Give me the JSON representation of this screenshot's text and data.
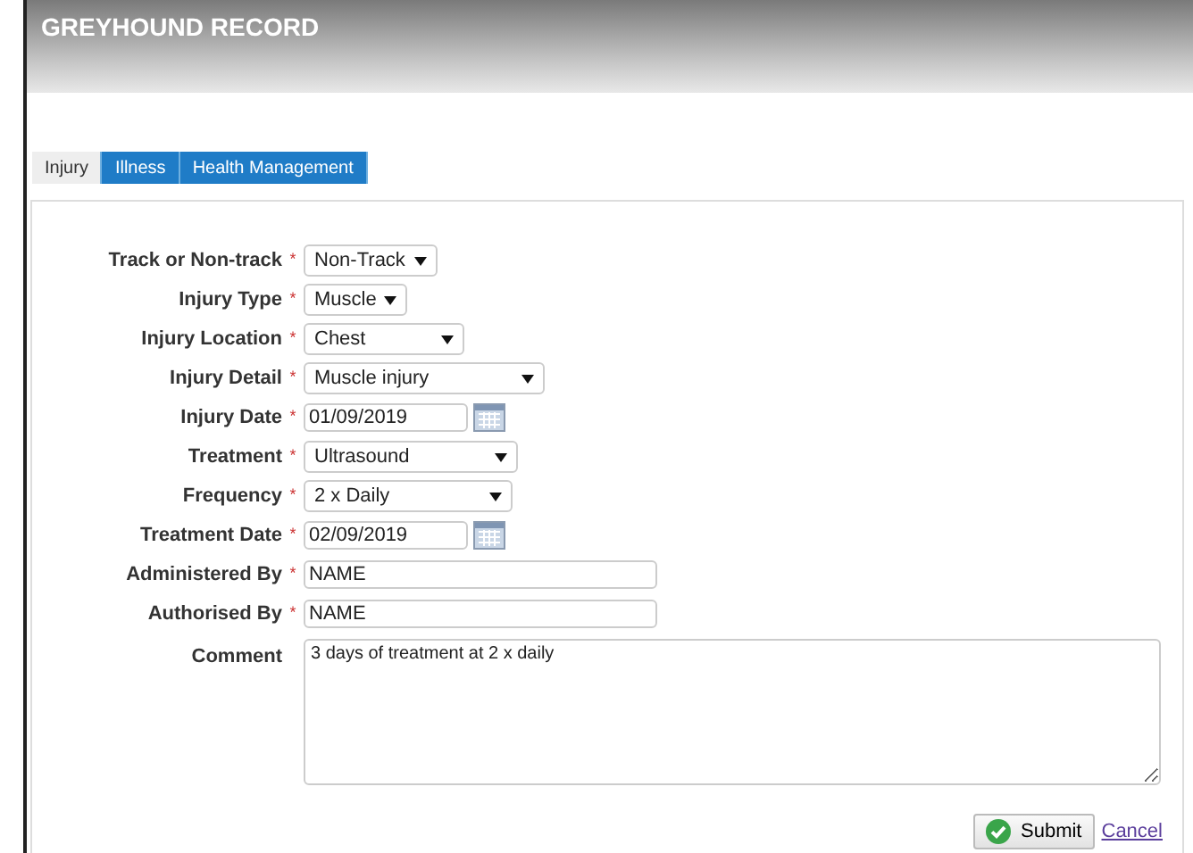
{
  "header": {
    "title": "GREYHOUND RECORD"
  },
  "tabs": [
    {
      "label": "Injury",
      "selected": true
    },
    {
      "label": "Illness",
      "selected": false
    },
    {
      "label": "Health Management",
      "selected": false
    }
  ],
  "fields": [
    {
      "kind": "select",
      "label": "Track or Non-track",
      "marker": "*",
      "value": "Non-Track"
    },
    {
      "kind": "select",
      "label": "Injury Type",
      "marker": "*",
      "value": "Muscle"
    },
    {
      "kind": "select",
      "label": "Injury Location",
      "marker": "*",
      "value": "Chest"
    },
    {
      "kind": "select",
      "label": "Injury Detail",
      "marker": "*",
      "value": "Muscle injury"
    },
    {
      "kind": "date",
      "label": "Injury Date",
      "marker": "*",
      "value": "01/09/2019"
    },
    {
      "kind": "select",
      "label": "Treatment",
      "marker": "*",
      "value": "Ultrasound"
    },
    {
      "kind": "select",
      "label": "Frequency",
      "marker": "*",
      "value": "2 x Daily"
    },
    {
      "kind": "date",
      "label": "Treatment Date",
      "marker": "*",
      "value": "02/09/2019"
    },
    {
      "kind": "text",
      "label": "Administered By",
      "marker": "*",
      "value": "NAME"
    },
    {
      "kind": "text",
      "label": "Authorised By",
      "marker": "*",
      "value": "NAME"
    },
    {
      "kind": "textarea",
      "label": "Comment",
      "value": "3 days of treatment at 2 x daily"
    }
  ],
  "actions": {
    "submit": "Submit",
    "cancel": "Cancel"
  }
}
